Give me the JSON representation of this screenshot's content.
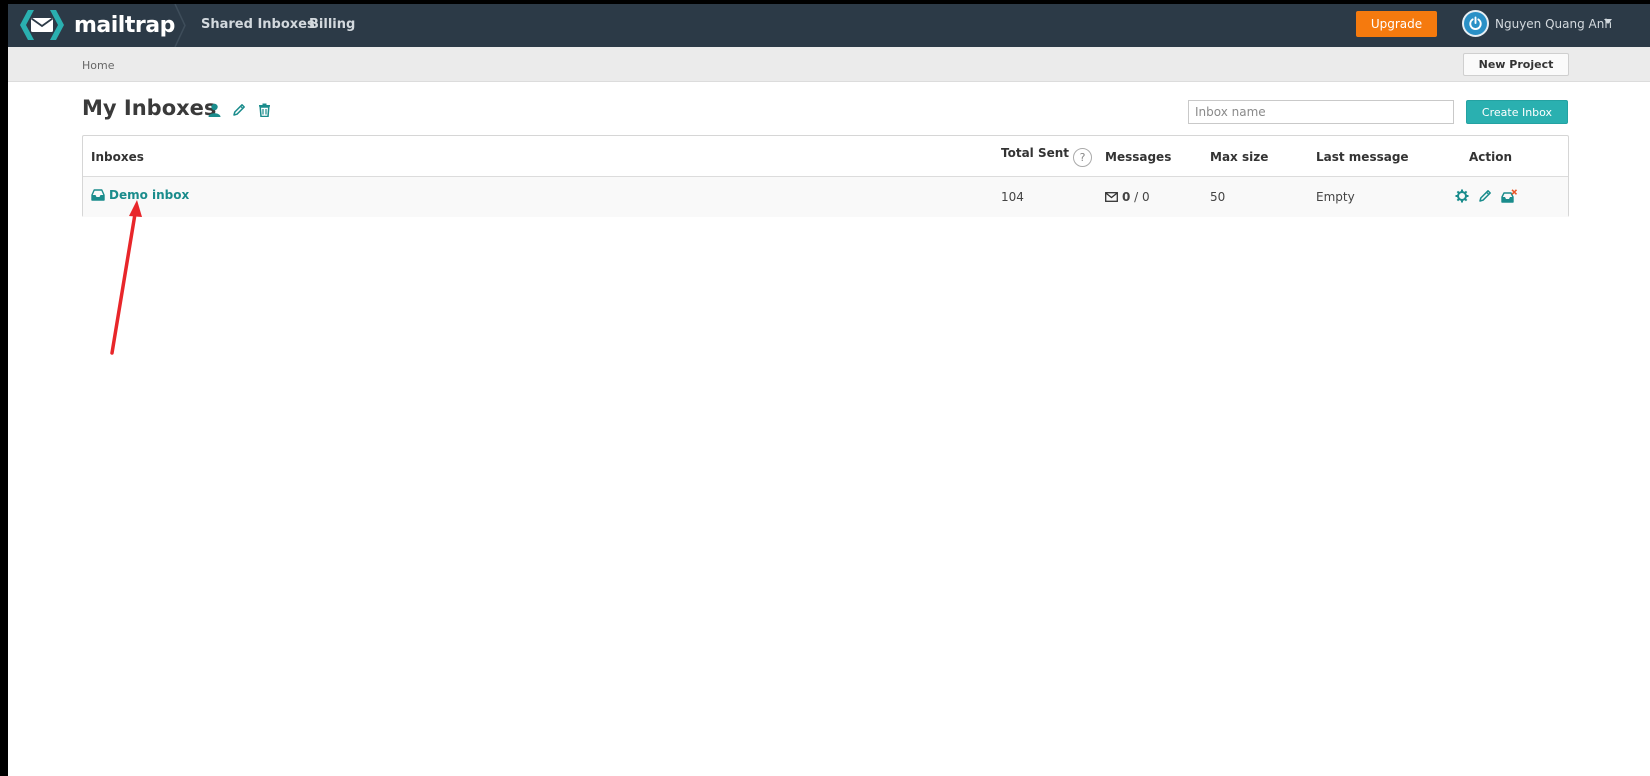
{
  "nav": {
    "logo_text": "mailtrap",
    "links": [
      {
        "label": "Shared Inboxes"
      },
      {
        "label": "Billing"
      }
    ],
    "upgrade_label": "Upgrade",
    "user_name": "Nguyen Quang Anh"
  },
  "subbar": {
    "breadcrumb": "Home",
    "new_project_label": "New Project"
  },
  "page": {
    "title": "My Inboxes",
    "search_placeholder": "Inbox name",
    "create_label": "Create Inbox"
  },
  "table": {
    "columns": [
      "Inboxes",
      "Total Sent",
      "Messages",
      "Max size",
      "Last message",
      "Action"
    ],
    "help_glyph": "?",
    "rows": [
      {
        "name": "Demo inbox",
        "total_sent": "104",
        "messages_unread": "0",
        "messages_sep": " / ",
        "messages_total": "0",
        "max_size": "50",
        "last_message": "Empty"
      }
    ]
  },
  "colors": {
    "nav_bg": "#2c3a47",
    "accent": "#2ab0b0",
    "upgrade": "#f57a0e",
    "link": "#1a8c8c",
    "annotation": "#e8262a"
  },
  "icons": [
    "mailtrap-logo-icon",
    "person-icon",
    "pencil-icon",
    "trash-icon",
    "power-icon",
    "inbox-tray-icon",
    "envelope-icon",
    "gear-icon",
    "clear-inbox-icon",
    "help-icon",
    "caret-down-icon"
  ]
}
